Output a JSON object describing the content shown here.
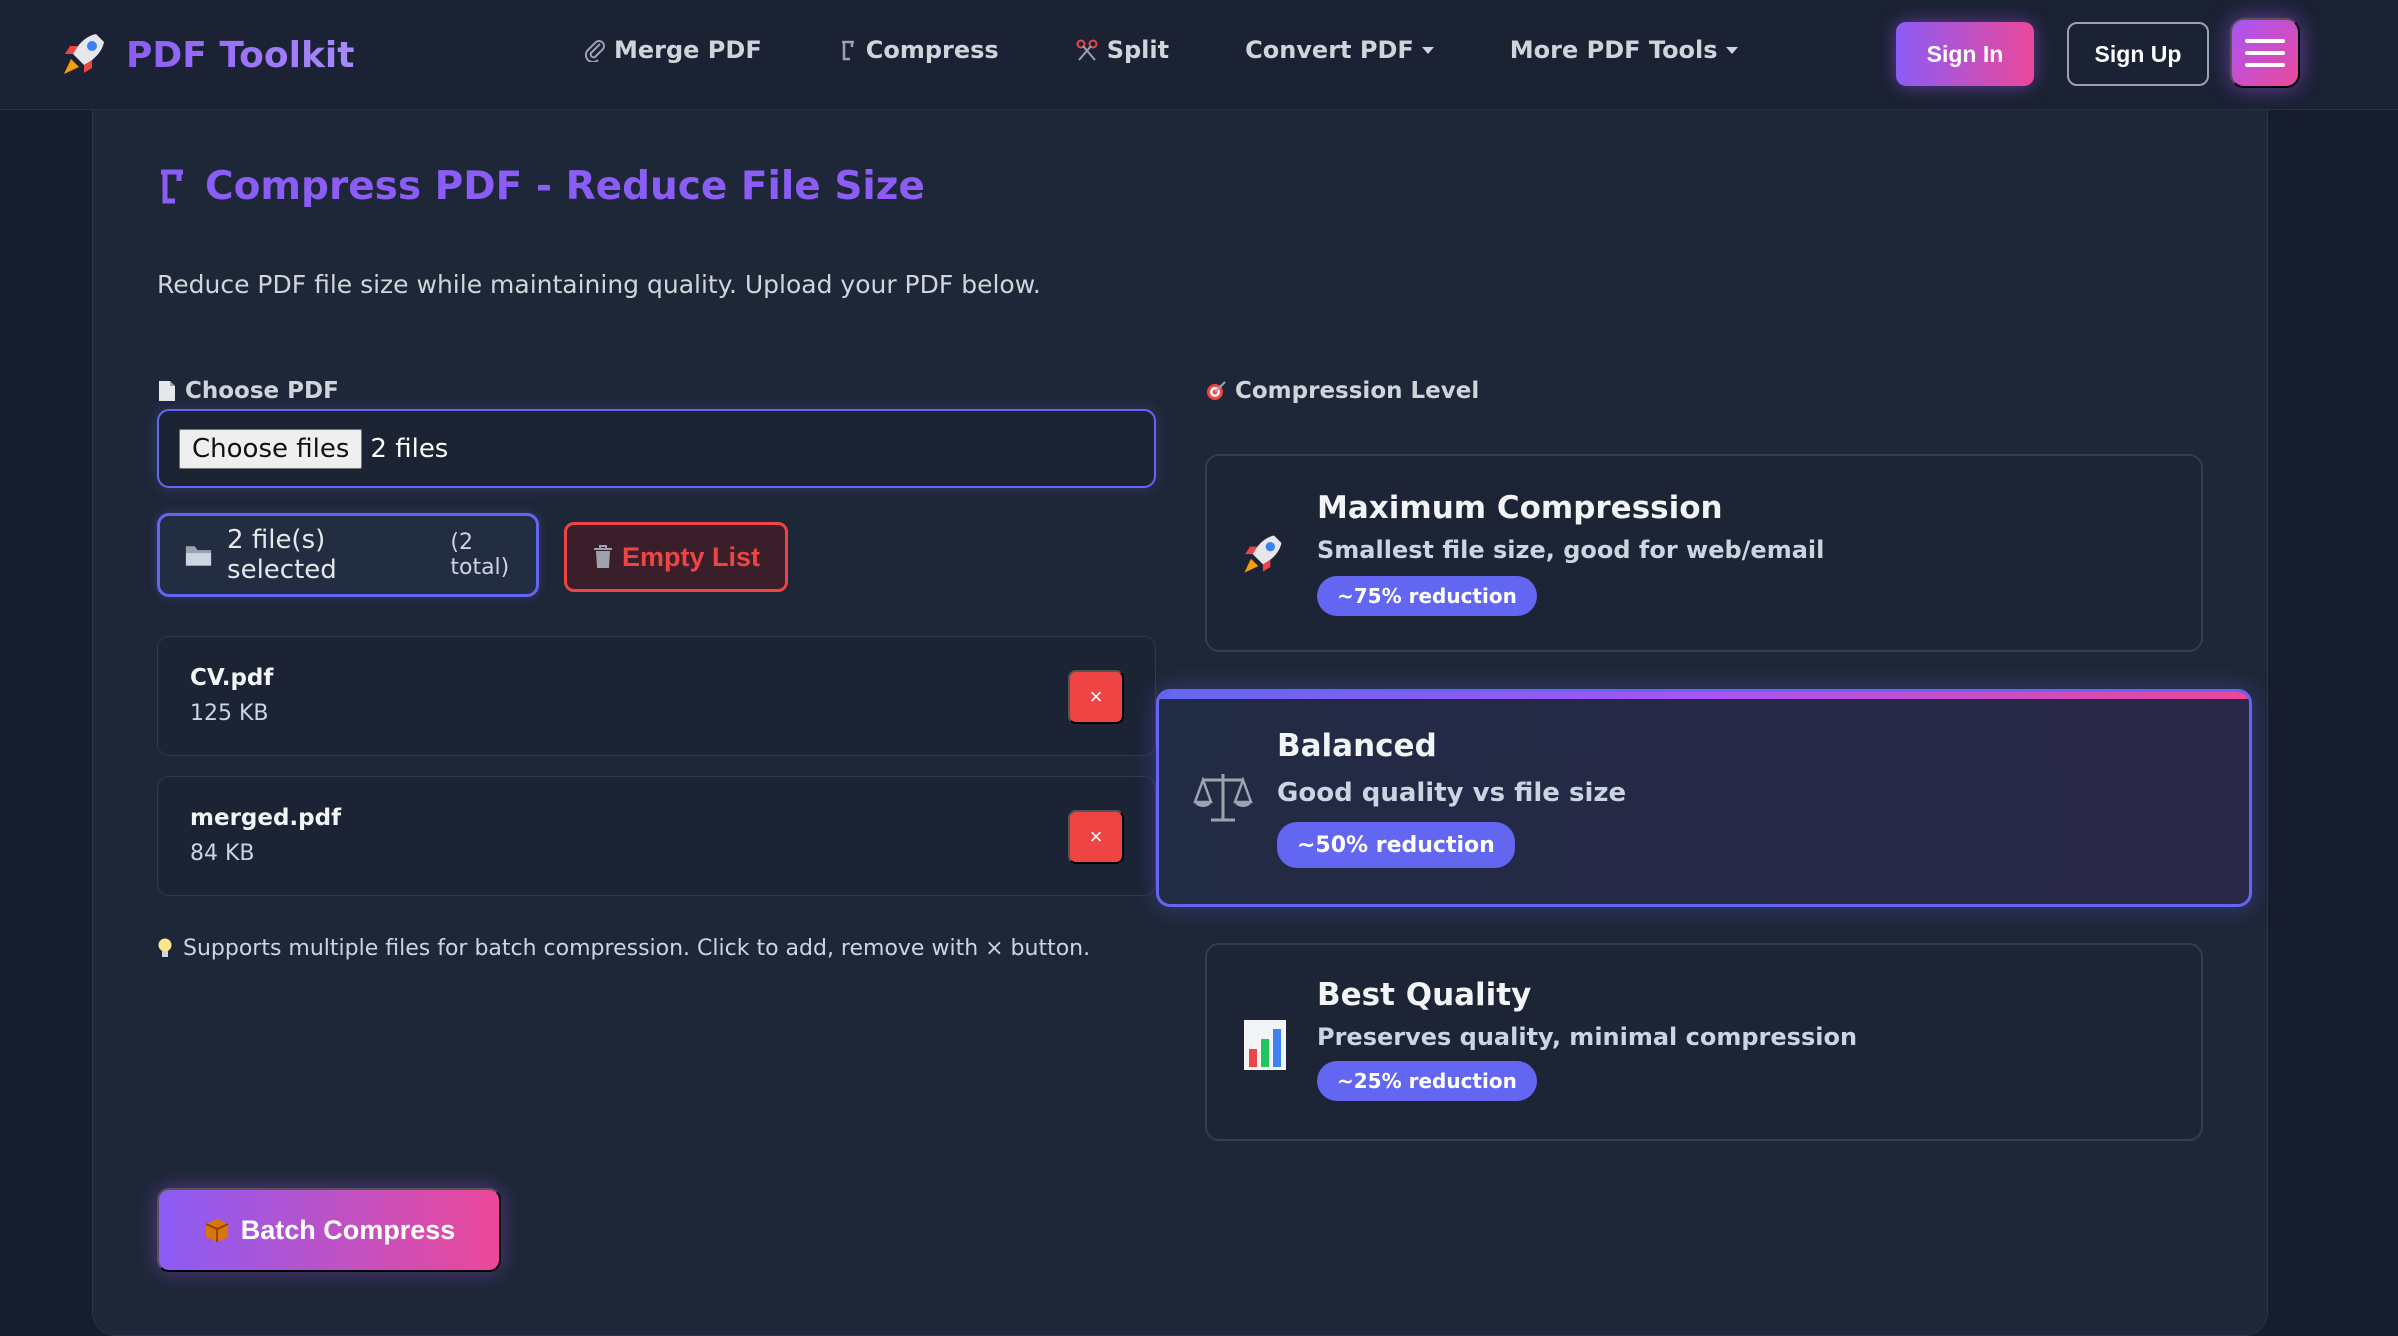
{
  "brand": {
    "name": "PDF Toolkit",
    "icon": "rocket-icon"
  },
  "nav": {
    "links": [
      {
        "label": "Merge PDF",
        "icon": "paperclip-icon"
      },
      {
        "label": "Compress",
        "icon": "clamp-icon"
      },
      {
        "label": "Split",
        "icon": "scissors-icon"
      },
      {
        "label": "Convert PDF",
        "icon": "chevron-down-icon"
      },
      {
        "label": "More PDF Tools",
        "icon": "chevron-down-icon"
      }
    ],
    "sign_in": "Sign In",
    "sign_up": "Sign Up",
    "menu_icon": "hamburger-icon"
  },
  "page": {
    "title": "Compress PDF - Reduce File Size",
    "description": "Reduce PDF file size while maintaining quality. Upload your PDF below."
  },
  "upload": {
    "label": "Choose PDF",
    "choose_button": "Choose files",
    "file_count": "2 files",
    "selected_text": "2 file(s) selected",
    "selected_total": "(2 total)",
    "empty_button": "Empty List",
    "files": [
      {
        "name": "CV.pdf",
        "size": "125 KB",
        "remove": "×"
      },
      {
        "name": "merged.pdf",
        "size": "84 KB",
        "remove": "×"
      }
    ],
    "hint": "Supports multiple files for batch compression. Click to add, remove with × button.",
    "batch_button": "Batch Compress"
  },
  "compression": {
    "label": "Compression Level",
    "options": [
      {
        "title": "Maximum Compression",
        "subtitle": "Smallest file size, good for web/email",
        "badge": "~75% reduction",
        "icon": "rocket-icon",
        "selected": false
      },
      {
        "title": "Balanced",
        "subtitle": "Good quality vs file size",
        "badge": "~50% reduction",
        "icon": "balance-scale-icon",
        "selected": true
      },
      {
        "title": "Best Quality",
        "subtitle": "Preserves quality, minimal compression",
        "badge": "~25% reduction",
        "icon": "bar-chart-icon",
        "selected": false
      }
    ]
  },
  "colors": {
    "accent": "#8b5cf6",
    "accent_pink": "#ec4899",
    "indigo": "#6366f1",
    "danger": "#ef4444",
    "background": "#161d2c"
  }
}
